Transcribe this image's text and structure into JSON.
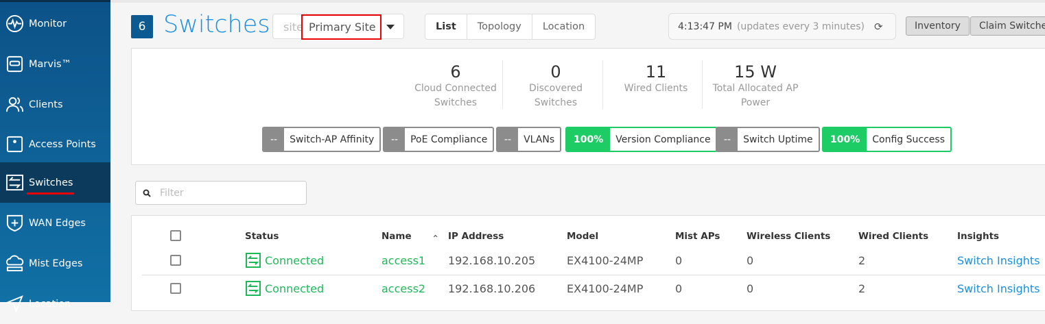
{
  "sidebar": {
    "items": [
      {
        "label": "Monitor",
        "icon": "monitor-icon"
      },
      {
        "label": "Marvis™",
        "icon": "marvis-icon"
      },
      {
        "label": "Clients",
        "icon": "clients-icon"
      },
      {
        "label": "Access Points",
        "icon": "access-point-icon"
      },
      {
        "label": "Switches",
        "icon": "switch-icon",
        "active": true
      },
      {
        "label": "WAN Edges",
        "icon": "wan-edge-icon"
      },
      {
        "label": "Mist Edges",
        "icon": "mist-edge-icon"
      },
      {
        "label": "Location",
        "icon": "location-icon"
      }
    ]
  },
  "header": {
    "count": "6",
    "title": "Switches",
    "site_placeholder": "site",
    "site_value": "Primary Site",
    "views": [
      "List",
      "Topology",
      "Location"
    ],
    "time": "4:13:47 PM",
    "update_note": "(updates every 3 minutes)",
    "inventory": "Inventory",
    "claim": "Claim Switches"
  },
  "stats": [
    {
      "value": "6",
      "label1": "Cloud Connected",
      "label2": "Switches"
    },
    {
      "value": "0",
      "label1": "Discovered",
      "label2": "Switches"
    },
    {
      "value": "11",
      "label1": "Wired Clients",
      "label2": ""
    },
    {
      "value": "15 W",
      "label1": "Total Allocated AP",
      "label2": "Power"
    }
  ],
  "badges": [
    {
      "value": "--",
      "label": "Switch-AP Affinity"
    },
    {
      "value": "--",
      "label": "PoE Compliance"
    },
    {
      "value": "--",
      "label": "VLANs"
    },
    {
      "value": "100%",
      "label": "Version Compliance"
    },
    {
      "value": "--",
      "label": "Switch Uptime"
    },
    {
      "value": "100%",
      "label": "Config Success"
    }
  ],
  "filter": {
    "placeholder": "Filter"
  },
  "table": {
    "headers": [
      "Status",
      "Name",
      "IP Address",
      "Model",
      "Mist APs",
      "Wireless Clients",
      "Wired Clients",
      "Insights"
    ],
    "rows": [
      [
        "Connected",
        "access1",
        "192.168.10.205",
        "EX4100-24MP",
        "0",
        "0",
        "2",
        "Switch Insights"
      ],
      [
        "Connected",
        "access2",
        "192.168.10.206",
        "EX4100-24MP",
        "0",
        "0",
        "2",
        "Switch Insights"
      ]
    ]
  },
  "colors": {
    "accent": "#1a8fe0",
    "connected": "#1eb85a",
    "sidebar": "#0c5288"
  }
}
